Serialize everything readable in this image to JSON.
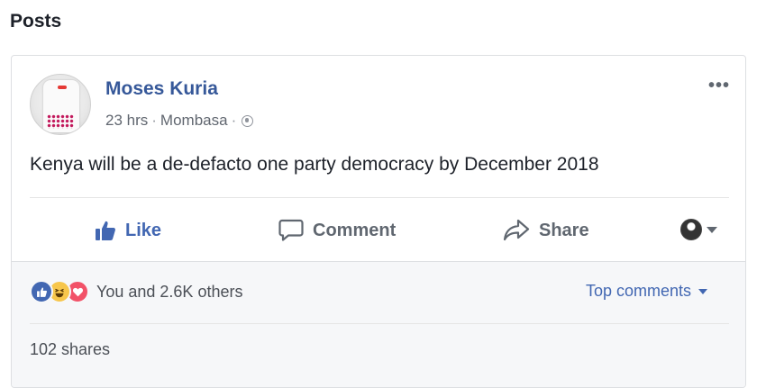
{
  "section": {
    "title": "Posts"
  },
  "post": {
    "author": "Moses Kuria",
    "time": "23 hrs",
    "location": "Mombasa",
    "text": "Kenya will be a de-defacto one party democracy by December 2018",
    "more_label": "•••",
    "audience_icon": "globe-icon"
  },
  "actions": {
    "like_label": "Like",
    "comment_label": "Comment",
    "share_label": "Share"
  },
  "footer": {
    "reaction_icons": [
      "like-reaction-icon",
      "haha-reaction-icon",
      "love-reaction-icon"
    ],
    "reaction_summary": "You and 2.6K others",
    "sort_label": "Top comments",
    "shares_text": "102 shares"
  },
  "colors": {
    "link_blue": "#365899",
    "like_blue": "#4267b2",
    "muted_text": "#616770",
    "footer_bg": "#f6f7f9",
    "love_red": "#f25268",
    "haha_yellow": "#f7c64b"
  }
}
